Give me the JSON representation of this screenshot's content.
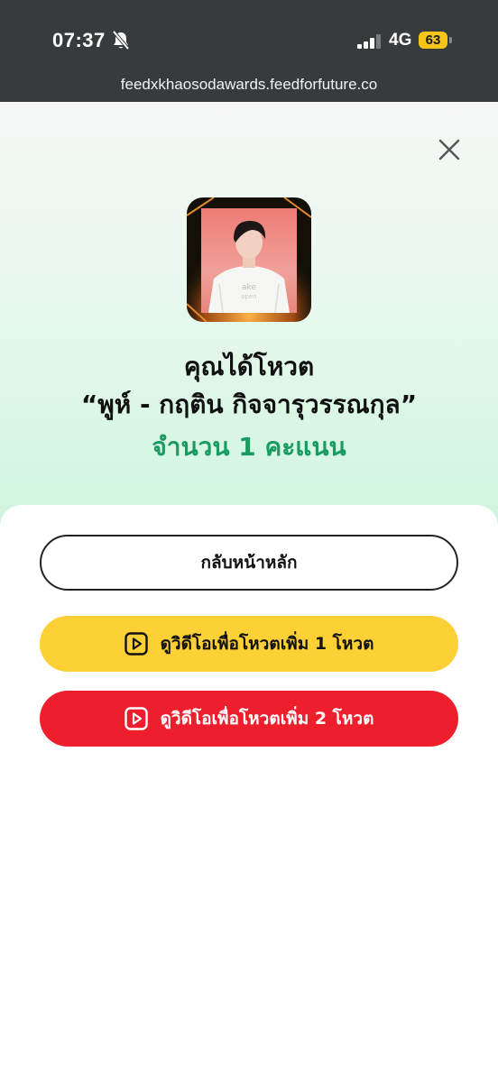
{
  "status_bar": {
    "time": "07:37",
    "network": "4G",
    "battery": "63",
    "url": "feedxkhaosodawards.feedforfuture.co"
  },
  "modal": {
    "headline": "คุณได้โหวต",
    "candidate": "“พูห์ - กฤติน กิจจารุวรรณกุล”",
    "vote_count_text": "จำนวน 1 คะแนน",
    "accent_color": "#1a9b62"
  },
  "buttons": {
    "home": "กลับหน้าหลัก",
    "watch_1": "ดูวิดีโอเพื่อโหวตเพิ่ม 1 โหวต",
    "watch_2": "ดูวิดีโอเพื่อโหวตเพิ่ม 2 โหวต"
  },
  "colors": {
    "status_bar": "#383b3e",
    "yellow_button": "#fdd035",
    "red_button": "#ee1f2c",
    "battery": "#f5c518"
  },
  "icons": {
    "close": "close-icon",
    "play": "play-icon",
    "mute": "bell-slash-icon",
    "signal": "signal-bars-icon"
  }
}
